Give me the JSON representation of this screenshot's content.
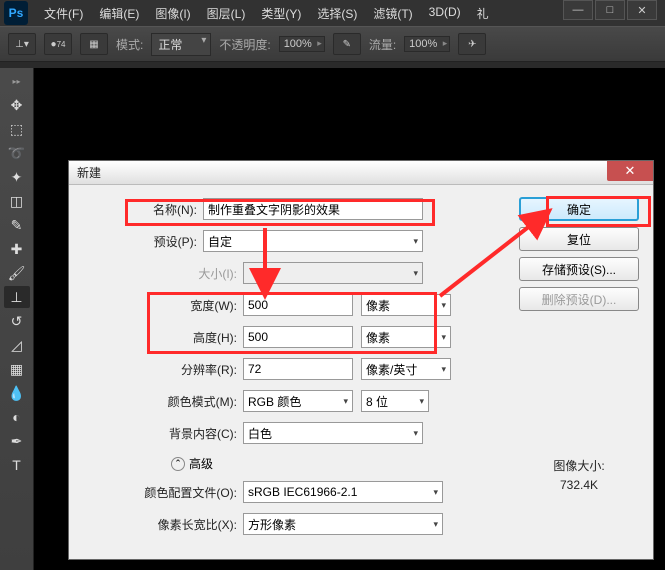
{
  "app_logo": "Ps",
  "menubar": [
    "文件(F)",
    "编辑(E)",
    "图像(I)",
    "图层(L)",
    "类型(Y)",
    "选择(S)",
    "滤镜(T)",
    "3D(D)",
    "礼"
  ],
  "optionsbar": {
    "brush_num": "74",
    "mode_label": "模式:",
    "mode_value": "正常",
    "opacity_label": "不透明度:",
    "opacity_value": "100%",
    "flow_label": "流量:",
    "flow_value": "100%"
  },
  "tools": [
    "▸▸",
    "▭",
    "⬚",
    "✦",
    "▭",
    "✂",
    "✎",
    "⌖",
    "▭",
    "✎",
    "✐",
    "⊥",
    "◿",
    "◓",
    "◆",
    "▭",
    "◐",
    "✎",
    "✒",
    "T"
  ],
  "dialog": {
    "title": "新建",
    "name_label": "名称(N):",
    "name_value": "制作重叠文字阴影的效果",
    "preset_label": "预设(P):",
    "preset_value": "自定",
    "size_label": "大小(I):",
    "width_label": "宽度(W):",
    "width_value": "500",
    "width_unit": "像素",
    "height_label": "高度(H):",
    "height_value": "500",
    "height_unit": "像素",
    "res_label": "分辨率(R):",
    "res_value": "72",
    "res_unit": "像素/英寸",
    "mode_label": "颜色模式(M):",
    "mode_value": "RGB 颜色",
    "bit_value": "8 位",
    "bg_label": "背景内容(C):",
    "bg_value": "白色",
    "adv_label": "高级",
    "profile_label": "颜色配置文件(O):",
    "profile_value": "sRGB IEC61966-2.1",
    "aspect_label": "像素长宽比(X):",
    "aspect_value": "方形像素",
    "ok": "确定",
    "reset": "复位",
    "save_preset": "存储预设(S)...",
    "del_preset": "删除预设(D)...",
    "size_info_label": "图像大小:",
    "size_info_value": "732.4K"
  }
}
